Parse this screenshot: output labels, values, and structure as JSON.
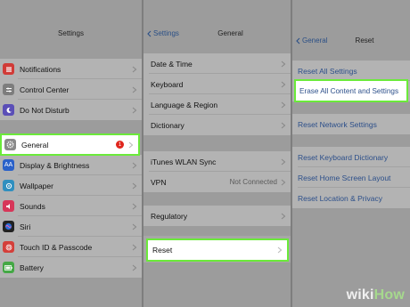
{
  "panel1": {
    "title": "Settings",
    "items": [
      {
        "label": "Notifications",
        "icon": "notifications-icon",
        "color": "#d13b37"
      },
      {
        "label": "Control Center",
        "icon": "control-center-icon",
        "color": "#7d7d7d"
      },
      {
        "label": "Do Not Disturb",
        "icon": "moon-icon",
        "color": "#5b4fb7"
      },
      {
        "label": "General",
        "icon": "gear-icon",
        "color": "#8a8a8a",
        "badge": "1"
      },
      {
        "label": "Display & Brightness",
        "icon": "display-icon",
        "color": "#2a61c9"
      },
      {
        "label": "Wallpaper",
        "icon": "wallpaper-icon",
        "color": "#2f8fbf"
      },
      {
        "label": "Sounds",
        "icon": "sounds-icon",
        "color": "#d73659"
      },
      {
        "label": "Siri",
        "icon": "siri-icon",
        "color": "#222222"
      },
      {
        "label": "Touch ID & Passcode",
        "icon": "fingerprint-icon",
        "color": "#d43f3a"
      },
      {
        "label": "Battery",
        "icon": "battery-icon",
        "color": "#44a845"
      }
    ]
  },
  "panel2": {
    "back": "Settings",
    "title": "General",
    "items": [
      {
        "label": "Date & Time"
      },
      {
        "label": "Keyboard"
      },
      {
        "label": "Language & Region"
      },
      {
        "label": "Dictionary"
      },
      {
        "label": "iTunes WLAN Sync"
      },
      {
        "label": "VPN",
        "value": "Not Connected"
      },
      {
        "label": "Regulatory"
      },
      {
        "label": "Reset"
      }
    ]
  },
  "panel3": {
    "back": "General",
    "title": "Reset",
    "items": [
      {
        "label": "Reset All Settings"
      },
      {
        "label": "Erase All Content and Settings"
      },
      {
        "label": "Reset Network Settings"
      },
      {
        "label": "Reset Keyboard Dictionary"
      },
      {
        "label": "Reset Home Screen Layout"
      },
      {
        "label": "Reset Location & Privacy"
      }
    ]
  },
  "watermark": {
    "wiki": "wiki",
    "how": "How"
  },
  "colors": {
    "highlight": "#6bea3a",
    "link": "#2c4f8a"
  }
}
